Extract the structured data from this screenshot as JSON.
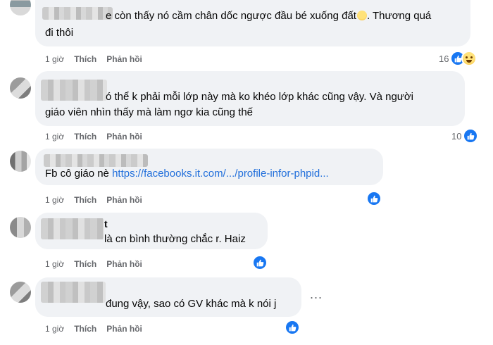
{
  "comments": [
    {
      "name_suffix": "",
      "text_lines": [
        "e còn thấy nó cầm chân dốc ngược đầu bé xuống đất",
        ". Thương quá",
        "đi thôi"
      ],
      "time": "1 giờ",
      "like": "Thích",
      "reply": "Phản hồi",
      "reaction_count": "16"
    },
    {
      "name_suffix": "",
      "text_lines": [
        "ó thể k phải mỗi lớp này mà ko khéo lớp khác cũng vậy. Và người",
        "giáo viên nhìn thấy mà làm ngơ kia cũng thế"
      ],
      "time": "1 giờ",
      "like": "Thích",
      "reply": "Phản hồi",
      "reaction_count": "10"
    },
    {
      "name_suffix": "",
      "text_prefix": "Fb cô giáo nè ",
      "link": "https://facebooks.it.com/.../profile-infor-phpid...",
      "time": "1 giờ",
      "like": "Thích",
      "reply": "Phản hồi",
      "reaction_count": ""
    },
    {
      "name_suffix": "t",
      "text_lines": [
        "là cn bình thường chắc r. Haiz"
      ],
      "time": "1 giờ",
      "like": "Thích",
      "reply": "Phản hồi",
      "reaction_count": ""
    },
    {
      "name_suffix": "",
      "text_lines": [
        "đung vậy, sao có GV khác mà k nói j"
      ],
      "time": "1 giờ",
      "like": "Thích",
      "reply": "Phản hồi",
      "reaction_count": "",
      "more": "..."
    }
  ],
  "colors": {
    "bubble": "#f0f2f5",
    "link": "#216fdb",
    "like": "#1877f2",
    "meta": "#65676b"
  },
  "icons": [
    "like-icon",
    "haha-icon",
    "sad-emoji-icon",
    "more-options-icon"
  ]
}
